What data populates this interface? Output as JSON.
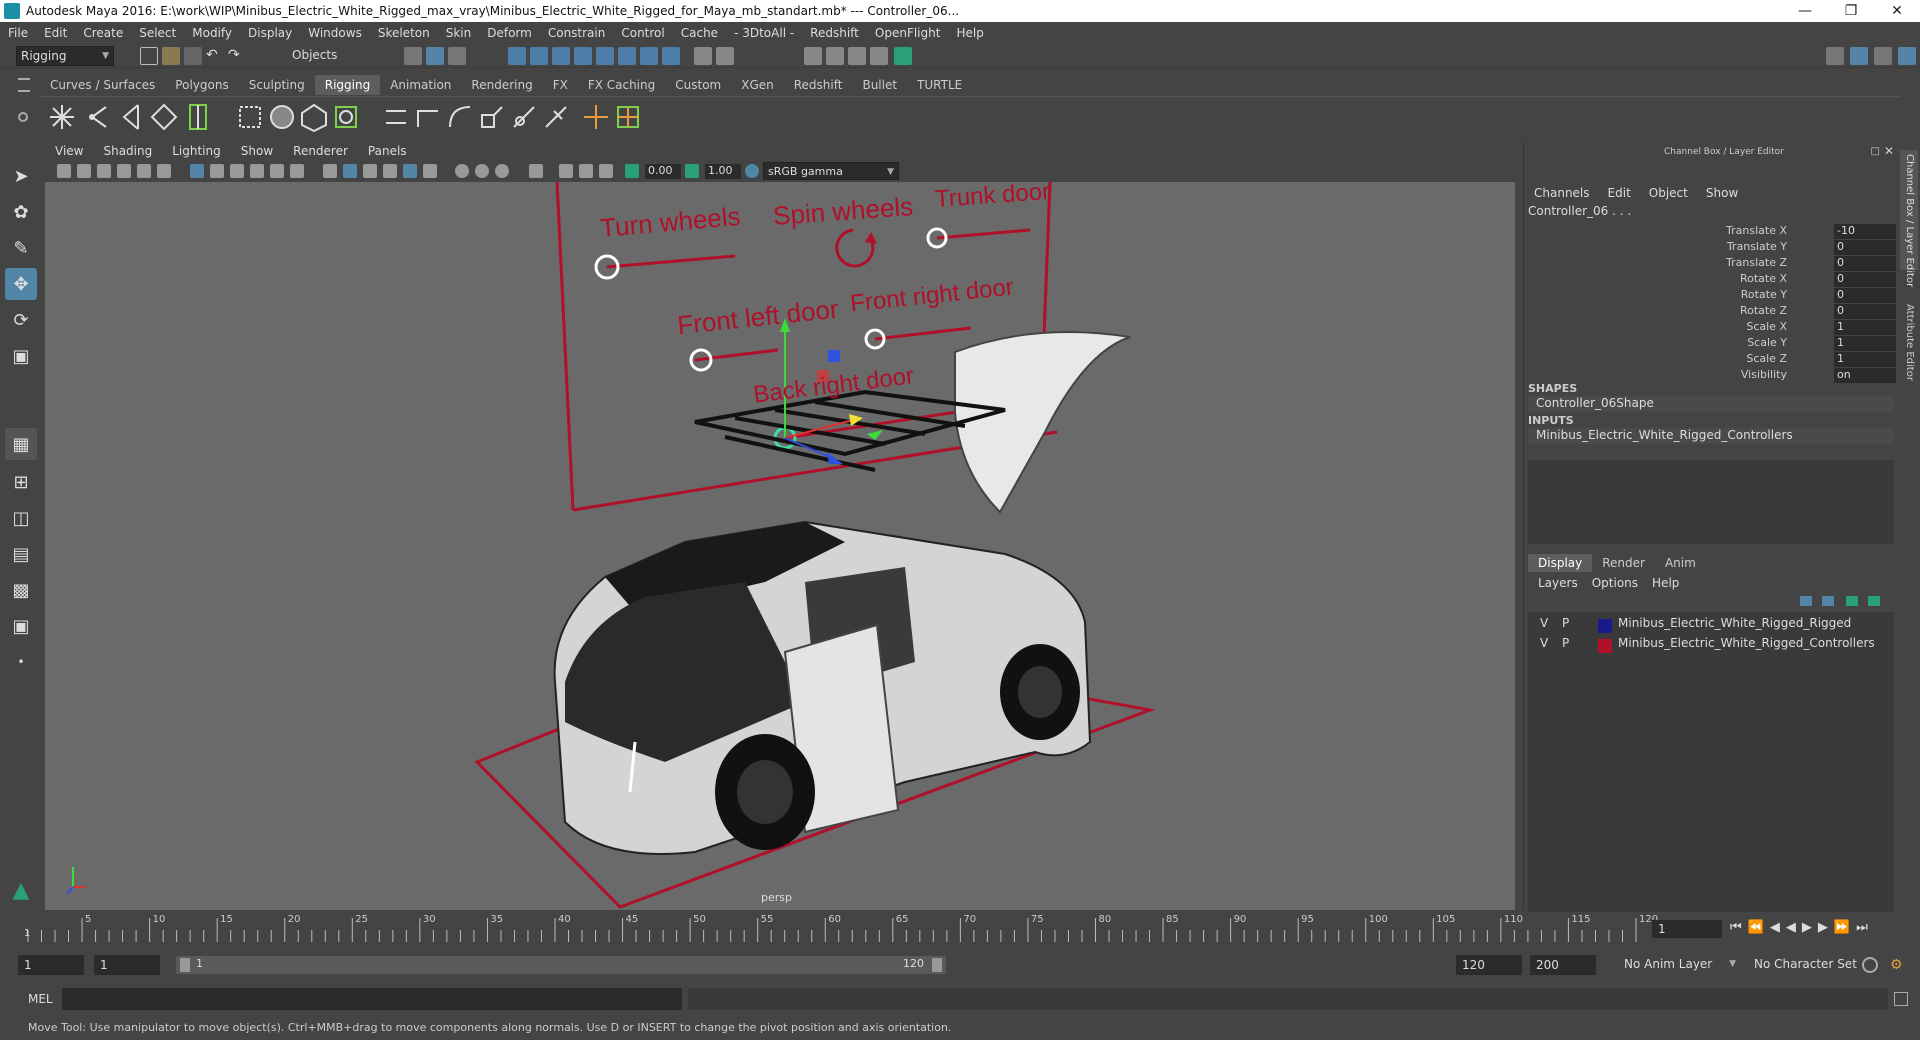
{
  "window": {
    "title": "Autodesk Maya 2016: E:\\work\\WIP\\Minibus_Electric_White_Rigged_max_vray\\Minibus_Electric_White_Rigged_for_Maya_mb_standart.mb*   ---   Controller_06..."
  },
  "menu": [
    "File",
    "Edit",
    "Create",
    "Select",
    "Modify",
    "Display",
    "Windows",
    "Skeleton",
    "Skin",
    "Deform",
    "Constrain",
    "Control",
    "Cache",
    "- 3DtoAll -",
    "Redshift",
    "OpenFlight",
    "Help"
  ],
  "statusline": {
    "mode": "Rigging",
    "selection_mode": "Objects"
  },
  "shelf_tabs": [
    "Curves / Surfaces",
    "Polygons",
    "Sculpting",
    "Rigging",
    "Animation",
    "Rendering",
    "FX",
    "FX Caching",
    "Custom",
    "XGen",
    "Redshift",
    "Bullet",
    "TURTLE"
  ],
  "shelf_active": "Rigging",
  "viewport": {
    "menu": [
      "View",
      "Shading",
      "Lighting",
      "Show",
      "Renderer",
      "Panels"
    ],
    "exposure": "0.00",
    "gamma": "1.00",
    "color_space": "sRGB gamma",
    "camera_label": "persp",
    "labels": {
      "turn_wheels": "Turn wheels",
      "spin_wheels": "Spin wheels",
      "trunk_door": "Trunk door",
      "front_left_door": "Front left door",
      "front_right_door": "Front right door",
      "back_right_door": "Back right door"
    }
  },
  "channel_box": {
    "header": "Channel Box / Layer Editor",
    "menu": [
      "Channels",
      "Edit",
      "Object",
      "Show"
    ],
    "node": "Controller_06 . . .",
    "attributes": [
      {
        "name": "Translate X",
        "value": "-10"
      },
      {
        "name": "Translate Y",
        "value": "0"
      },
      {
        "name": "Translate Z",
        "value": "0"
      },
      {
        "name": "Rotate X",
        "value": "0"
      },
      {
        "name": "Rotate Y",
        "value": "0"
      },
      {
        "name": "Rotate Z",
        "value": "0"
      },
      {
        "name": "Scale X",
        "value": "1"
      },
      {
        "name": "Scale Y",
        "value": "1"
      },
      {
        "name": "Scale Z",
        "value": "1"
      },
      {
        "name": "Visibility",
        "value": "on"
      }
    ],
    "shapes_label": "SHAPES",
    "shape": "Controller_06Shape",
    "inputs_label": "INPUTS",
    "input": "Minibus_Electric_White_Rigged_Controllers",
    "side_tabs": [
      "Channel Box / Layer Editor",
      "Attribute Editor"
    ]
  },
  "layer_editor": {
    "tabs": [
      "Display",
      "Render",
      "Anim"
    ],
    "active_tab": "Display",
    "menu": [
      "Layers",
      "Options",
      "Help"
    ],
    "layers": [
      {
        "v": "V",
        "p": "P",
        "color": "#1a1a8a",
        "name": "Minibus_Electric_White_Rigged_Rigged"
      },
      {
        "v": "V",
        "p": "P",
        "color": "#b0102a",
        "name": "Minibus_Electric_White_Rigged_Controllers"
      }
    ]
  },
  "timeline": {
    "ticks": [
      "5",
      "10",
      "15",
      "20",
      "25",
      "30",
      "35",
      "40",
      "45",
      "50",
      "55",
      "60",
      "65",
      "70",
      "75",
      "80",
      "85",
      "90",
      "95",
      "100",
      "105",
      "110",
      "115",
      "120"
    ],
    "first_tick": "1",
    "current_frame": "1"
  },
  "range": {
    "start": "1",
    "playback_start": "1",
    "slider_start": "1",
    "slider_end": "120",
    "playback_end": "120",
    "end": "200",
    "anim_layer": "No Anim Layer",
    "character_set": "No Character Set"
  },
  "command_line": {
    "label": "MEL"
  },
  "help_line": "Move Tool: Use manipulator to move object(s). Ctrl+MMB+drag to move components along normals. Use D or INSERT to change the pivot position and axis orientation."
}
